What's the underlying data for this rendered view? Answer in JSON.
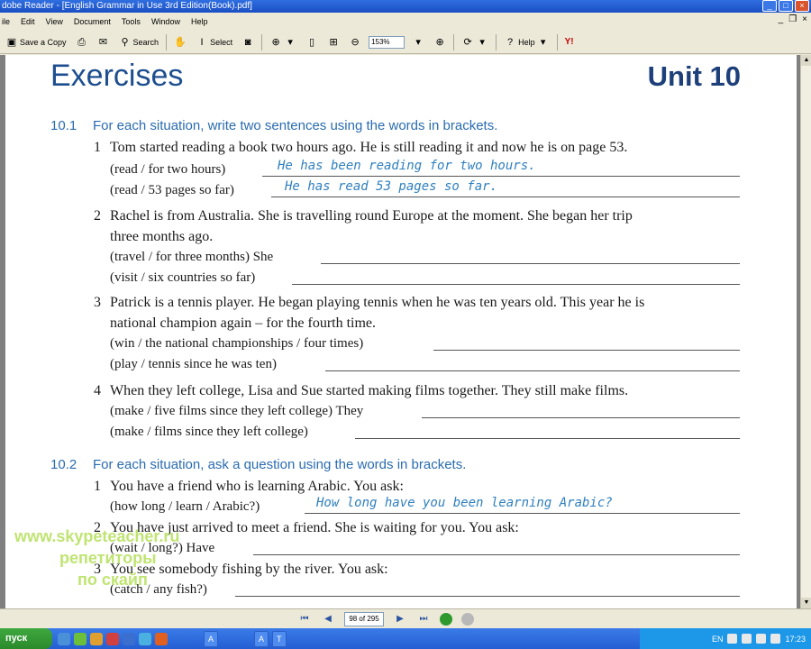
{
  "window": {
    "title": "dobe Reader - [English Grammar in Use 3rd Edition(Book).pdf]"
  },
  "menu": [
    "ile",
    "Edit",
    "View",
    "Document",
    "Tools",
    "Window",
    "Help"
  ],
  "toolbar": {
    "save_copy": "Save a Copy",
    "search": "Search",
    "select": "Select",
    "zoom": "153%",
    "help": "Help"
  },
  "document": {
    "heading": "Exercises",
    "unit": "Unit 10",
    "exercises": [
      {
        "number": "10.1",
        "title": "For each situation, write two sentences using the words in brackets.",
        "items": [
          {
            "num": "1",
            "lines": [
              "Tom started reading a book two hours ago. He is still reading it and now he is on page 53."
            ],
            "prompts": [
              {
                "text": "(read / for two hours)",
                "answer": "He has been reading for two hours."
              },
              {
                "text": "(read / 53 pages so far)",
                "answer": "He has read 53 pages so far."
              }
            ]
          },
          {
            "num": "2",
            "lines": [
              "Rachel is from Australia. She is travelling round Europe at the moment. She began her trip",
              "three months ago."
            ],
            "prompts": [
              {
                "text": "(travel / for three months)  She",
                "answer": ""
              },
              {
                "text": "(visit / six countries so far)",
                "answer": ""
              }
            ]
          },
          {
            "num": "3",
            "lines": [
              "Patrick is a tennis player. He began playing tennis when he was ten years old. This year he is",
              "national champion again – for the fourth time."
            ],
            "prompts": [
              {
                "text": "(win / the national championships / four times)",
                "answer": ""
              },
              {
                "text": "(play / tennis since he was ten)",
                "answer": ""
              }
            ]
          },
          {
            "num": "4",
            "lines": [
              "When they left college, Lisa and Sue started making films together. They still make films."
            ],
            "prompts": [
              {
                "text": "(make / five films since they left college)  They",
                "answer": ""
              },
              {
                "text": "(make / films since they left college)",
                "answer": ""
              }
            ]
          }
        ]
      },
      {
        "number": "10.2",
        "title": "For each situation, ask a question using the words in brackets.",
        "items": [
          {
            "num": "1",
            "lines": [
              "You have a friend who is learning Arabic. You ask:"
            ],
            "prompts": [
              {
                "text": "(how long / learn / Arabic?)",
                "answer": "How long have you been learning Arabic?"
              }
            ]
          },
          {
            "num": "2",
            "lines": [
              "You have just arrived to meet a friend. She is waiting for you. You ask:"
            ],
            "prompts": [
              {
                "text": "(wait / long?)  Have",
                "answer": ""
              }
            ]
          },
          {
            "num": "3",
            "lines": [
              "You see somebody fishing by the river. You ask:"
            ],
            "prompts": [
              {
                "text": "(catch / any fish?)",
                "answer": ""
              }
            ]
          }
        ]
      }
    ]
  },
  "watermark": {
    "line1": "www.skypeteacher.ru",
    "line2": "репетиторы",
    "line3": "по скайп"
  },
  "navbar": {
    "page_indicator": "98 of 295"
  },
  "taskbar": {
    "start": "пуск",
    "lang": "EN",
    "clock": "17:23",
    "tasks": [
      "A",
      "A",
      "T"
    ]
  }
}
